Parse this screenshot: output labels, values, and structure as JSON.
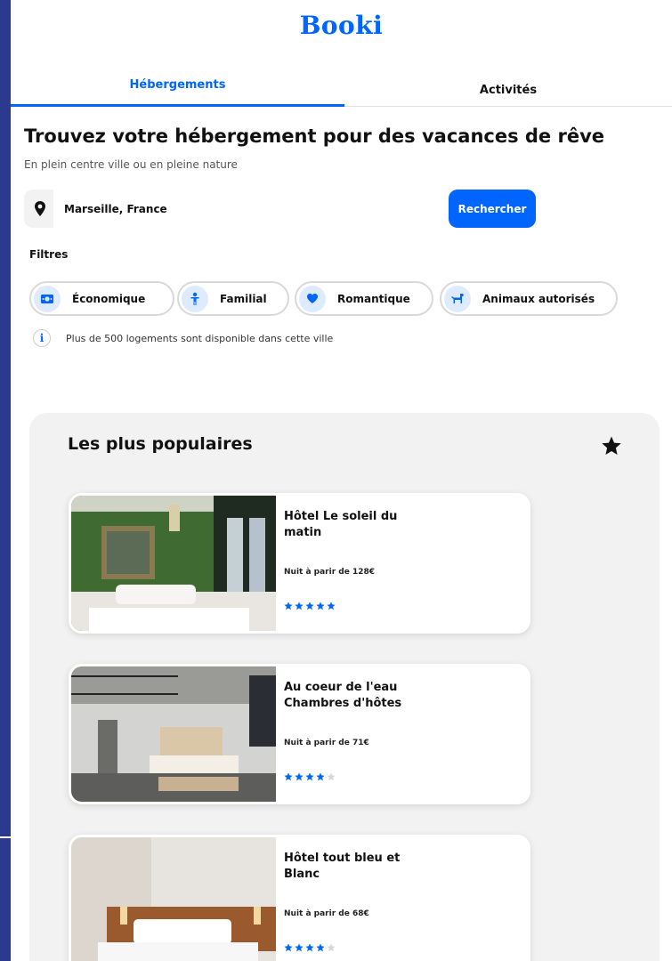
{
  "brand": {
    "logo": "Booki",
    "accent": "#0065fc"
  },
  "tabs": [
    {
      "label": "Hébergements",
      "active": true
    },
    {
      "label": "Activités",
      "active": false
    }
  ],
  "hero": {
    "title": "Trouvez votre hébergement pour des vacances de rêve",
    "subtitle": "En plein centre ville ou en pleine nature"
  },
  "search": {
    "icon": "location-pin-icon",
    "value": "Marseille, France",
    "button_label": "Rechercher"
  },
  "filters": {
    "label": "Filtres",
    "items": [
      {
        "label": "Économique",
        "icon": "money-icon"
      },
      {
        "label": "Familial",
        "icon": "child-icon"
      },
      {
        "label": "Romantique",
        "icon": "heart-icon"
      },
      {
        "label": "Animaux autorisés",
        "icon": "dog-icon"
      }
    ]
  },
  "info": {
    "icon": "info-icon",
    "text": "Plus de 500 logements sont disponible dans cette ville"
  },
  "popular": {
    "title": "Les plus populaires",
    "icon": "star-icon",
    "cards": [
      {
        "name": "Hôtel Le soleil du matin",
        "price": "Nuit à parir de 128€",
        "rating": 5,
        "max_rating": 5
      },
      {
        "name": "Au coeur de l'eau Chambres d'hôtes",
        "price": "Nuit à parir de 71€",
        "rating": 4,
        "max_rating": 5
      },
      {
        "name": "Hôtel tout bleu et Blanc",
        "price": "Nuit à parir de 68€",
        "rating": 4,
        "max_rating": 5
      }
    ]
  }
}
